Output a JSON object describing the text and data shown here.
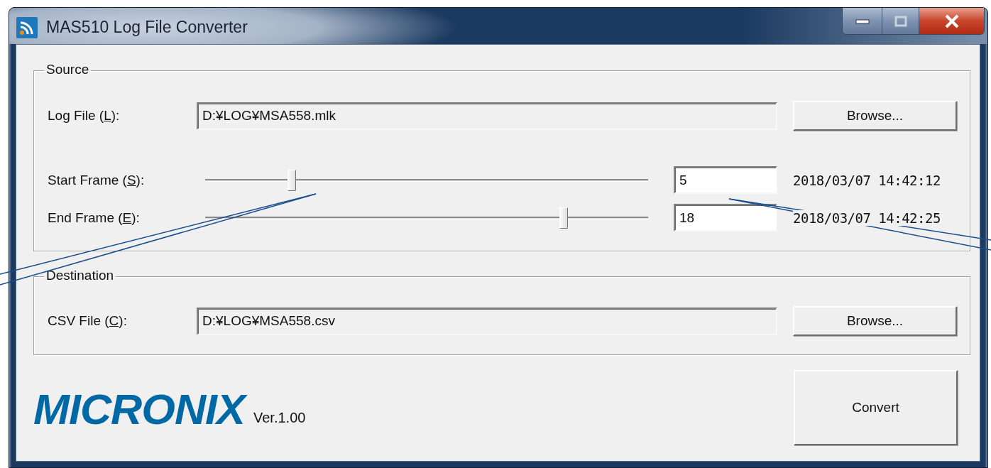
{
  "window": {
    "title": "MAS510 Log File Converter"
  },
  "source": {
    "legend": "Source",
    "log_file": {
      "label": [
        "Log File (",
        "L",
        "):"
      ],
      "value": "D:¥LOG¥MSA558.mlk",
      "button": "Browse..."
    },
    "frames": [
      {
        "label": [
          "Start Frame (",
          "S",
          "):"
        ],
        "level": 0.196,
        "value": "5",
        "timestamp": "2018/03/07 14:42:12"
      },
      {
        "label": [
          "End Frame (",
          "E",
          "):"
        ],
        "level": 0.81,
        "value": "18",
        "timestamp": "2018/03/07 14:42:25"
      }
    ]
  },
  "destination": {
    "legend": "Destination",
    "csv_file": {
      "label": [
        "CSV File (",
        "C",
        "):"
      ],
      "value": "D:¥LOG¥MSA558.csv",
      "button": "Browse..."
    }
  },
  "logo": "MICRONIX",
  "version": "Ver.1.00",
  "convert_button": "Convert"
}
